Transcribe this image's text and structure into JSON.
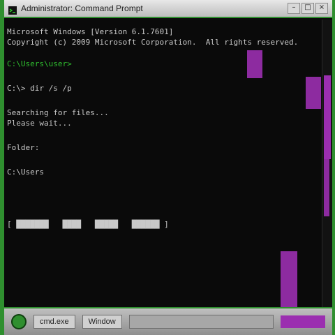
{
  "window": {
    "title": "Administrator: Command Prompt"
  },
  "console": {
    "lines": [
      "Microsoft Windows [Version 6.1.7601]",
      "Copyright (c) 2009 Microsoft Corporation.  All rights reserved.",
      "C:\\Users\\user> ",
      "C:\\> dir /s /p",
      "Searching for files...",
      "Please wait...",
      "Folder:",
      "C:\\Users",
      "[ ███████   ████   █████   ██████ ]"
    ]
  },
  "taskbar": {
    "task1_label": "cmd.exe",
    "task2_label": "Window"
  },
  "icons": {
    "title_icon": "terminal-icon",
    "minimize": "–",
    "maximize": "□",
    "close": "×"
  },
  "colors": {
    "accent": "#2f8f2f",
    "highlight": "#9b2fb0"
  }
}
